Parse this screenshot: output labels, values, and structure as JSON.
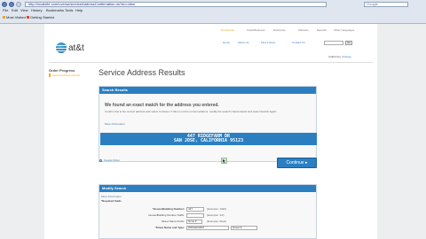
{
  "browser": {
    "url": "http://localsite.com/uverse/serviceAddressConfirmation.do?do=view",
    "search_placeholder": "Google",
    "menu": [
      "File",
      "Edit",
      "View",
      "History",
      "Bookmarks",
      "Tools",
      "Help"
    ],
    "favorites": [
      "Most Visited",
      "Getting Started"
    ]
  },
  "top_tabs": [
    "Residential",
    "Small Business",
    "Enterprise",
    "Wireless",
    "Español",
    "Other Languages"
  ],
  "logo_text": "at&t",
  "util_nav": [
    "Home",
    "About Us",
    "Find a Store",
    "Contact Us"
  ],
  "go_label": "Go",
  "account": {
    "prefix": "California",
    "link": "Change"
  },
  "sidebar": {
    "title": "Order Progress",
    "step": "Service Address Result"
  },
  "page_title": "Service Address Results",
  "results": {
    "header": "Search Results",
    "match_msg": "We found an exact match for the address you entered.",
    "confirm_msg": "Confirm this is the correct address and select Continue. If this is not the correct address, modify the search criteria below and select Search Again.",
    "more_info": "More Information",
    "address_line1": "447 RIDGEFARM DR",
    "address_line2": "SAN JOSE, CALIFORNIA 95123"
  },
  "cancel_label": "Cancel Order",
  "continue_label": "Continue",
  "modify": {
    "header": "Modify Search",
    "more_info": "More Information",
    "required_note": "*Required fields",
    "fields": [
      {
        "label": "*House/Building Number:",
        "value": "447",
        "example": "(Example: 1020)"
      },
      {
        "label": "House/Building Number Suffix:",
        "value": "",
        "example": "(Example: 1/2)"
      },
      {
        "label": "Street Name Prefix:",
        "value": "None",
        "example": "(Example: West)"
      },
      {
        "label": "*Street Name and Type:",
        "value": "RIDGEFARM",
        "example": "Street"
      }
    ]
  }
}
